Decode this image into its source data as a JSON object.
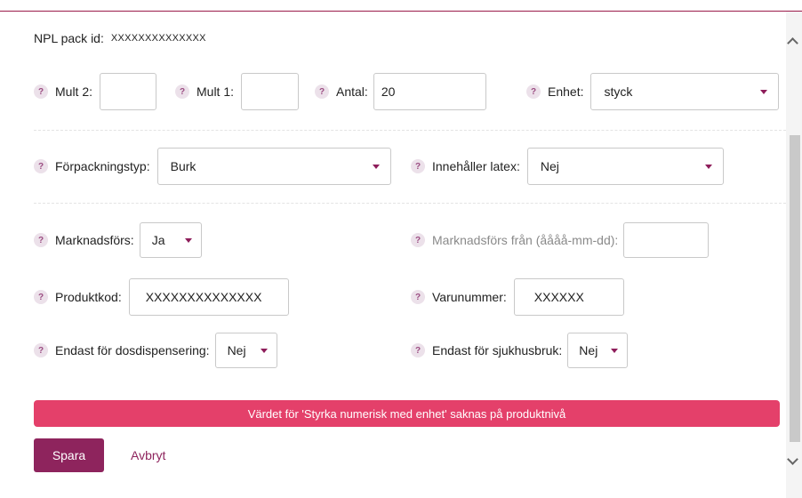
{
  "header": {
    "pack_id_label": "NPL pack id:",
    "pack_id_value": "XXXXXXXXXXXXXX"
  },
  "help_glyph": "?",
  "row1": {
    "mult2": {
      "label": "Mult 2:",
      "value": ""
    },
    "mult1": {
      "label": "Mult 1:",
      "value": ""
    },
    "antal": {
      "label": "Antal:",
      "value": "20"
    },
    "enhet": {
      "label": "Enhet:",
      "value": "styck"
    }
  },
  "row2": {
    "forpackningstyp": {
      "label": "Förpackningstyp:",
      "value": "Burk"
    },
    "latex": {
      "label": "Innehåller latex:",
      "value": "Nej"
    }
  },
  "row3": {
    "marknadsfors": {
      "label": "Marknadsförs:",
      "value": "Ja"
    },
    "marknadsfors_fran": {
      "label": "Marknadsförs från (åååå-mm-dd):",
      "value": ""
    }
  },
  "row4": {
    "produktkod": {
      "label": "Produktkod:",
      "value": "XXXXXXXXXXXXXX"
    },
    "varunummer": {
      "label": "Varunummer:",
      "value": "XXXXXX"
    }
  },
  "row5": {
    "dosdispensering": {
      "label": "Endast för dosdispensering:",
      "value": "Nej"
    },
    "sjukhusbruk": {
      "label": "Endast för sjukhusbruk:",
      "value": "Nej"
    }
  },
  "error": {
    "message": "Värdet för 'Styrka numerisk med enhet' saknas på produktnivå"
  },
  "actions": {
    "save_label": "Spara",
    "cancel_label": "Avbryt"
  },
  "colors": {
    "accent": "#8e245d",
    "error": "#e4406a",
    "help_bg": "#ece1ea"
  }
}
